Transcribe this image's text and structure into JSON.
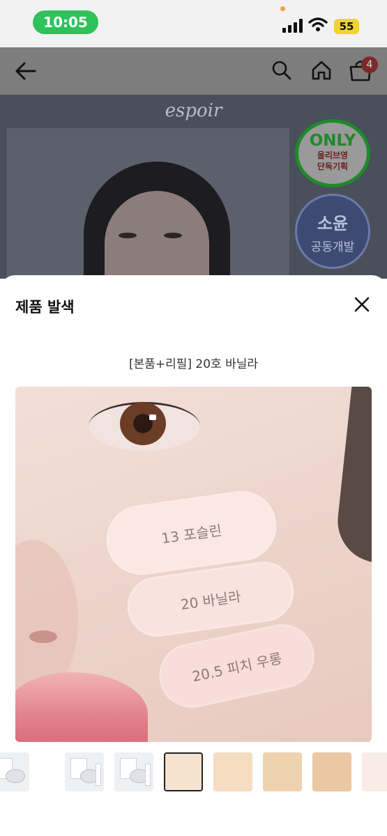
{
  "status_bar": {
    "time": "10:05",
    "battery": "55"
  },
  "header": {
    "back_icon": "arrow-left-icon",
    "search_icon": "search-icon",
    "home_icon": "home-icon",
    "cart_icon": "cart-icon",
    "cart_count": "4"
  },
  "banner": {
    "brand": "espoir",
    "badge_only": {
      "title": "ONLY",
      "line1": "올리브영",
      "line2": "단독기획"
    },
    "badge_collab": {
      "title": "소윤",
      "subtitle": "공동개발"
    }
  },
  "sheet": {
    "title": "제품 발색",
    "close_icon": "close-icon",
    "option_label": "[본품+리필] 20호 바닐라",
    "swatch_labels": [
      "13 포슬린",
      "20 바닐라",
      "20.5 피치 우롱"
    ]
  },
  "colors": {
    "status_pill": "#2fc25b",
    "battery": "#f2d42c",
    "cart_badge": "#c0392b",
    "badge_only_green": "#1f8a2a"
  }
}
